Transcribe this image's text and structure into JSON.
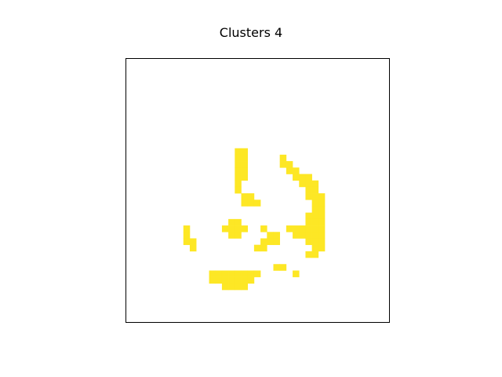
{
  "chart_data": {
    "type": "heatmap",
    "title": "Clusters 4",
    "xlabel": "",
    "ylabel": "",
    "grid": false,
    "axes_visible": false,
    "matrix_size": [
      41,
      41
    ],
    "colors": {
      "filled": "#fde725",
      "background": "#ffffff",
      "frame": "#000000"
    },
    "filled_cells": [
      [
        14,
        17
      ],
      [
        14,
        18
      ],
      [
        15,
        17
      ],
      [
        15,
        18
      ],
      [
        16,
        17
      ],
      [
        16,
        18
      ],
      [
        17,
        17
      ],
      [
        17,
        18
      ],
      [
        18,
        17
      ],
      [
        18,
        18
      ],
      [
        15,
        24
      ],
      [
        16,
        24
      ],
      [
        16,
        25
      ],
      [
        17,
        25
      ],
      [
        17,
        26
      ],
      [
        18,
        26
      ],
      [
        18,
        27
      ],
      [
        18,
        28
      ],
      [
        19,
        27
      ],
      [
        19,
        28
      ],
      [
        19,
        29
      ],
      [
        20,
        28
      ],
      [
        20,
        29
      ],
      [
        21,
        28
      ],
      [
        21,
        29
      ],
      [
        21,
        30
      ],
      [
        22,
        29
      ],
      [
        22,
        30
      ],
      [
        23,
        29
      ],
      [
        23,
        30
      ],
      [
        24,
        28
      ],
      [
        24,
        29
      ],
      [
        24,
        30
      ],
      [
        25,
        28
      ],
      [
        25,
        29
      ],
      [
        25,
        30
      ],
      [
        26,
        25
      ],
      [
        26,
        26
      ],
      [
        26,
        27
      ],
      [
        26,
        28
      ],
      [
        26,
        29
      ],
      [
        26,
        30
      ],
      [
        27,
        26
      ],
      [
        27,
        27
      ],
      [
        27,
        28
      ],
      [
        27,
        29
      ],
      [
        27,
        30
      ],
      [
        28,
        28
      ],
      [
        28,
        29
      ],
      [
        28,
        30
      ],
      [
        29,
        29
      ],
      [
        29,
        30
      ],
      [
        30,
        28
      ],
      [
        30,
        29
      ],
      [
        19,
        17
      ],
      [
        20,
        17
      ],
      [
        21,
        18
      ],
      [
        21,
        19
      ],
      [
        22,
        18
      ],
      [
        22,
        19
      ],
      [
        22,
        20
      ],
      [
        25,
        16
      ],
      [
        25,
        17
      ],
      [
        26,
        15
      ],
      [
        26,
        16
      ],
      [
        26,
        17
      ],
      [
        26,
        18
      ],
      [
        27,
        16
      ],
      [
        27,
        17
      ],
      [
        26,
        21
      ],
      [
        27,
        22
      ],
      [
        27,
        23
      ],
      [
        28,
        21
      ],
      [
        28,
        22
      ],
      [
        28,
        23
      ],
      [
        29,
        20
      ],
      [
        29,
        21
      ],
      [
        26,
        9
      ],
      [
        27,
        9
      ],
      [
        28,
        9
      ],
      [
        28,
        10
      ],
      [
        29,
        10
      ],
      [
        32,
        23
      ],
      [
        32,
        24
      ],
      [
        33,
        26
      ],
      [
        33,
        13
      ],
      [
        33,
        14
      ],
      [
        33,
        15
      ],
      [
        33,
        16
      ],
      [
        33,
        17
      ],
      [
        33,
        18
      ],
      [
        33,
        19
      ],
      [
        33,
        20
      ],
      [
        34,
        13
      ],
      [
        34,
        14
      ],
      [
        34,
        15
      ],
      [
        34,
        16
      ],
      [
        34,
        17
      ],
      [
        34,
        18
      ],
      [
        34,
        19
      ],
      [
        35,
        15
      ],
      [
        35,
        16
      ],
      [
        35,
        17
      ],
      [
        35,
        18
      ]
    ]
  }
}
